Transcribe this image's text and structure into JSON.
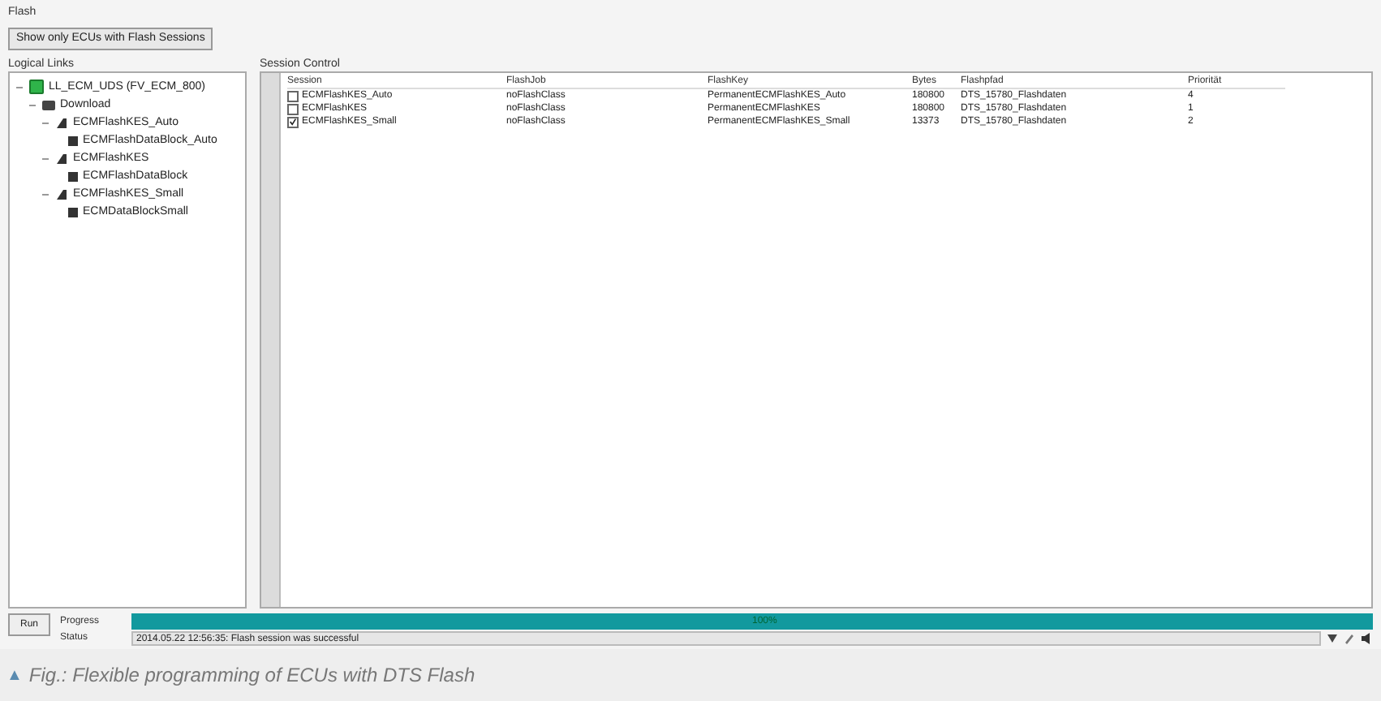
{
  "flash_group": {
    "title": "Flash",
    "button": "Show only ECUs with Flash Sessions"
  },
  "logical_links": {
    "title": "Logical Links",
    "tree": [
      {
        "label": "LL_ECM_UDS (FV_ECM_800)",
        "kind": "link",
        "expanded": true,
        "children": [
          {
            "label": "Download",
            "kind": "folder",
            "expanded": true,
            "children": [
              {
                "label": "ECMFlashKES_Auto",
                "kind": "session",
                "expanded": true,
                "children": [
                  {
                    "label": "ECMFlashDataBlock_Auto",
                    "kind": "block"
                  }
                ]
              },
              {
                "label": "ECMFlashKES",
                "kind": "session",
                "expanded": true,
                "children": [
                  {
                    "label": "ECMFlashDataBlock",
                    "kind": "block"
                  }
                ]
              },
              {
                "label": "ECMFlashKES_Small",
                "kind": "session",
                "expanded": true,
                "children": [
                  {
                    "label": "ECMDataBlockSmall",
                    "kind": "block"
                  }
                ]
              }
            ]
          }
        ]
      }
    ]
  },
  "session_control": {
    "title": "Session Control",
    "columns": [
      "Session",
      "FlashJob",
      "FlashKey",
      "Bytes",
      "Flashpfad",
      "Priorität"
    ],
    "rows": [
      {
        "checked": false,
        "cells": [
          "ECMFlashKES_Auto",
          "noFlashClass",
          "PermanentECMFlashKES_Auto",
          "180800",
          "DTS_15780_Flashdaten",
          "4"
        ]
      },
      {
        "checked": false,
        "cells": [
          "ECMFlashKES",
          "noFlashClass",
          "PermanentECMFlashKES",
          "180800",
          "DTS_15780_Flashdaten",
          "1"
        ]
      },
      {
        "checked": true,
        "cells": [
          "ECMFlashKES_Small",
          "noFlashClass",
          "PermanentECMFlashKES_Small",
          "13373",
          "DTS_15780_Flashdaten",
          "2"
        ]
      }
    ]
  },
  "bottom": {
    "run_button": "Run",
    "progress_label": "Progress",
    "progress": {
      "level": 1,
      "reading": "100%"
    },
    "status_label": "Status",
    "status": "2014.05.22 12:56:35: Flash session was successful"
  },
  "caption": {
    "marker": "▲",
    "text": "Fig.: Flexible programming of ECUs with DTS Flash"
  }
}
